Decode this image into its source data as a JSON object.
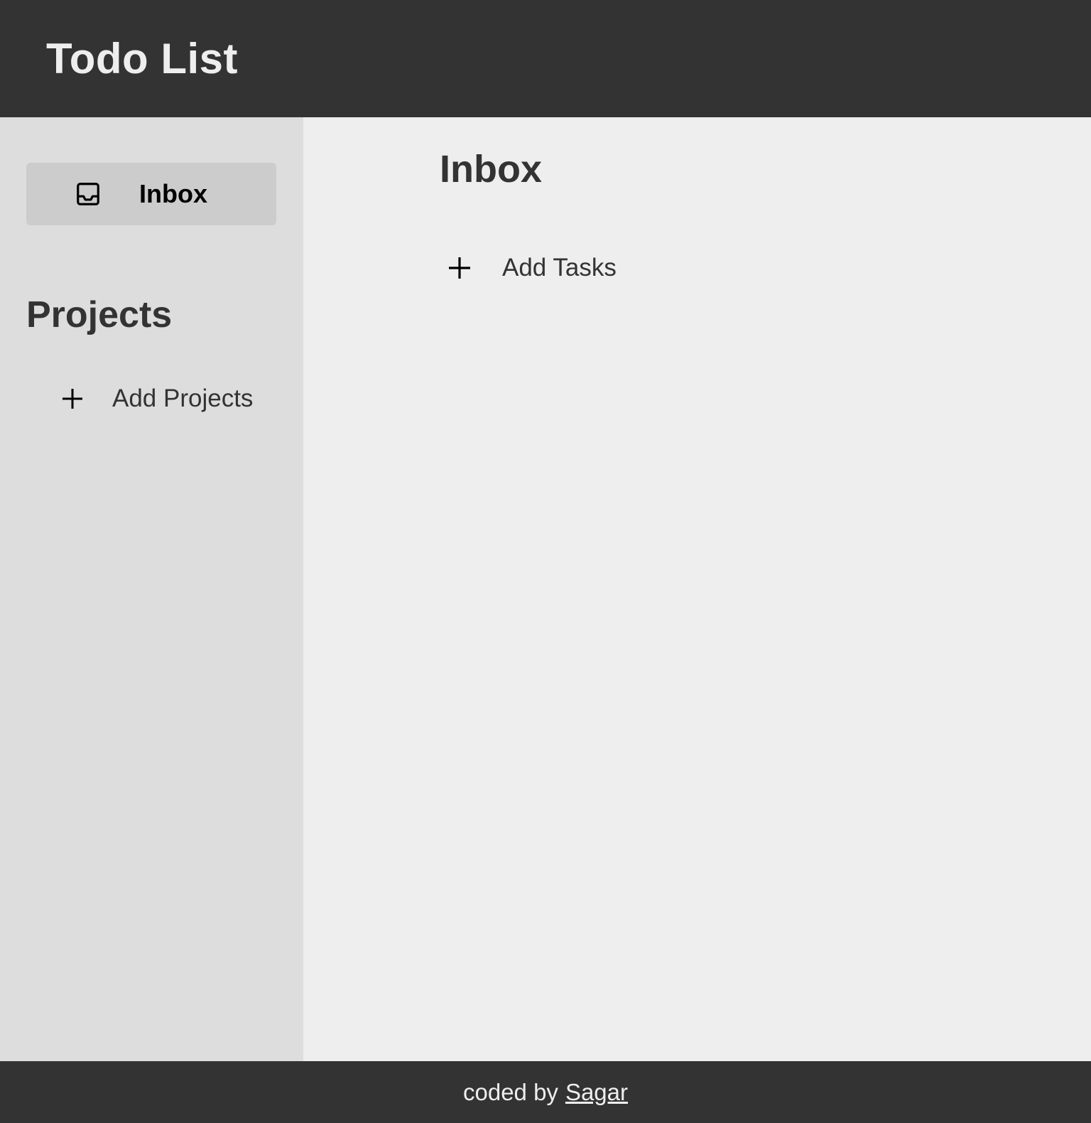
{
  "header": {
    "title": "Todo List"
  },
  "sidebar": {
    "items": [
      {
        "label": "Inbox",
        "icon": "inbox-icon"
      }
    ],
    "projects_heading": "Projects",
    "add_projects_label": "Add Projects",
    "add_projects_icon": "plus-icon"
  },
  "main": {
    "title": "Inbox",
    "add_tasks_label": "Add Tasks",
    "add_tasks_icon": "plus-icon"
  },
  "footer": {
    "prefix": "coded by",
    "author_link": "Sagar"
  },
  "colors": {
    "header_bg": "#333333",
    "sidebar_bg": "#dddddd",
    "active_item_bg": "#cccccc",
    "main_bg": "#eeeeee",
    "text_dark": "#333333",
    "text_light": "#eeeeee"
  }
}
